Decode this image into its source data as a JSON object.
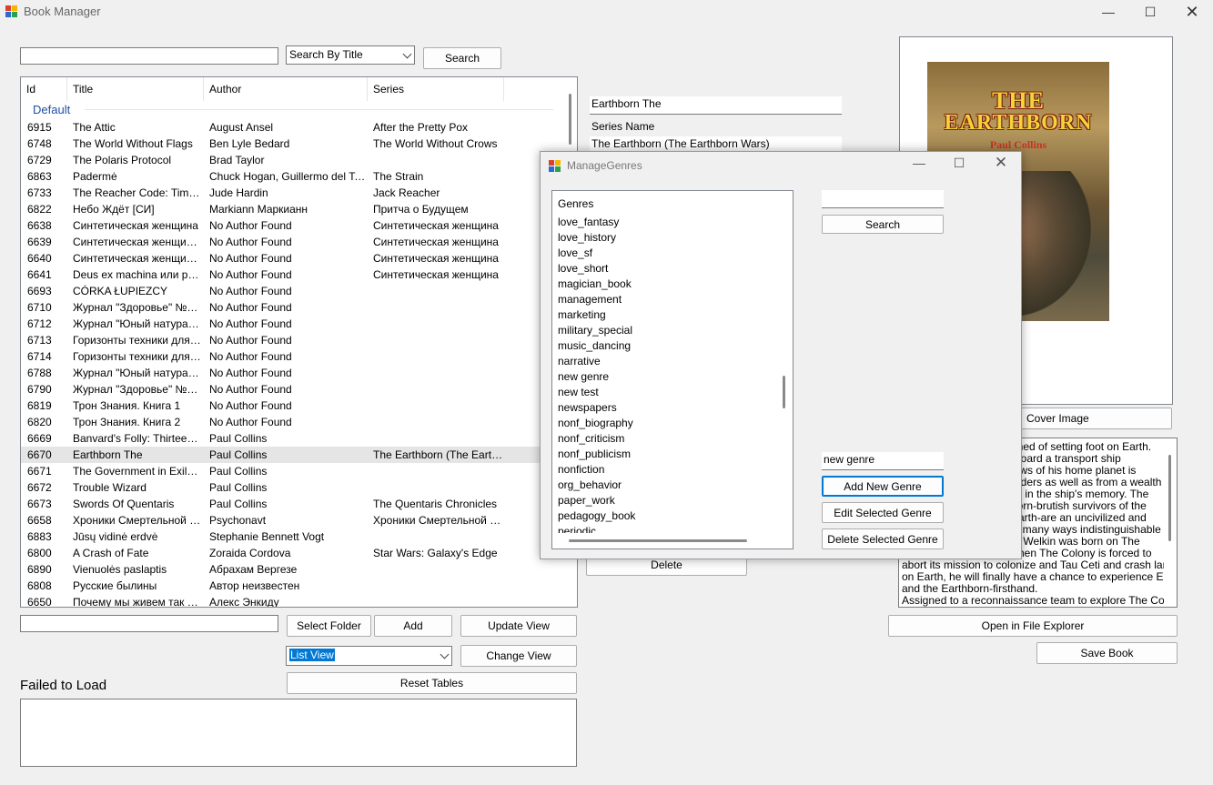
{
  "window": {
    "title": "Book Manager"
  },
  "search": {
    "query": "",
    "mode": "Search By Title",
    "button": "Search"
  },
  "table": {
    "columns": [
      "Id",
      "Title",
      "Author",
      "Series"
    ],
    "group": "Default",
    "rows": [
      [
        "6915",
        "The Attic",
        "August Ansel",
        "After the Pretty Pox"
      ],
      [
        "6748",
        "The World Without Flags",
        "Ben Lyle Bedard",
        "The World Without Crows"
      ],
      [
        "6729",
        "The Polaris Protocol",
        "Brad Taylor",
        ""
      ],
      [
        "6863",
        "Padermė",
        "Chuck Hogan, Guillermo del Toro",
        "The Strain"
      ],
      [
        "6733",
        "The Reacher Code: Timest...",
        "Jude Hardin",
        "Jack Reacher"
      ],
      [
        "6822",
        "Небо Ждёт [СИ]",
        "Markiann Маркианн",
        "Притча о Будущем"
      ],
      [
        "6638",
        "Синтетическая женщина",
        "No Author Found",
        "Синтетическая женщина"
      ],
      [
        "6639",
        "Синтетическая женщина 2",
        "No Author Found",
        "Синтетическая женщина"
      ],
      [
        "6640",
        "Синтетическая женщина 3",
        "No Author Found",
        "Синтетическая женщина"
      ],
      [
        "6641",
        "Deus ex machina или раз...",
        "No Author Found",
        "Синтетическая женщина"
      ],
      [
        "6693",
        "CÓRKA ŁUPIEZCY",
        "No Author Found",
        ""
      ],
      [
        "6710",
        "Журнал \"Здоровье\" №3 (...",
        "No Author Found",
        ""
      ],
      [
        "6712",
        "Журнал \"Юный натурали...",
        "No Author Found",
        ""
      ],
      [
        "6713",
        "Горизонты техники для д...",
        "No Author Found",
        ""
      ],
      [
        "6714",
        "Горизонты техники для д...",
        "No Author Found",
        ""
      ],
      [
        "6788",
        "Журнал \"Юный натурали...",
        "No Author Found",
        ""
      ],
      [
        "6790",
        "Журнал \"Здоровье\" №4 (...",
        "No Author Found",
        ""
      ],
      [
        "6819",
        "Трон Знания. Книга 1",
        "No Author Found",
        ""
      ],
      [
        "6820",
        "Трон Знания. Книга 2",
        "No Author Found",
        ""
      ],
      [
        "6669",
        "Banvard's Folly: Thirteen T...",
        "Paul Collins",
        ""
      ],
      [
        "6670",
        "Earthborn The",
        "Paul Collins",
        "The Earthborn (The Earthb..."
      ],
      [
        "6671",
        "The Government in Exile a...",
        "Paul Collins",
        ""
      ],
      [
        "6672",
        "Trouble Wizard",
        "Paul Collins",
        ""
      ],
      [
        "6673",
        "Swords Of Quentaris",
        "Paul Collins",
        "The Quentaris Chronicles"
      ],
      [
        "6658",
        "Хроники Смертельной Б...",
        "Psychonavt",
        "Хроники Смертельной Б..."
      ],
      [
        "6883",
        "Jūsų vidinė erdvė",
        "Stephanie Bennett Vogt",
        ""
      ],
      [
        "6800",
        "A Crash of Fate",
        "Zoraida Cordova",
        "Star Wars: Galaxy's Edge"
      ],
      [
        "6890",
        "Vienuolės paslaptis",
        "Абрахам Вергезе",
        ""
      ],
      [
        "6808",
        "Русские былины",
        "Автор неизвестен",
        ""
      ],
      [
        "6650",
        "Почему мы живем так м...",
        "Алекс Энкиду",
        ""
      ]
    ],
    "selected_id": "6670"
  },
  "folder": {
    "path": "",
    "select_button": "Select Folder",
    "add_button": "Add",
    "update_button": "Update View"
  },
  "view": {
    "mode": "List View",
    "change_button": "Change View",
    "reset_button": "Reset Tables"
  },
  "failed": {
    "label": "Failed to Load",
    "content": ""
  },
  "details": {
    "title": "Earthborn The",
    "series_label": "Series Name",
    "series": "The Earthborn (The Earthborn Wars)",
    "delete_button": "Delete"
  },
  "cover": {
    "title_line1": "THE",
    "title_line2": "EARTHBORN",
    "author": "Paul Collins",
    "button_visible": "Cover Image"
  },
  "description": {
    "lines": [
      "eamed of setting foot on Earth.",
      "r aboard a transport ship",
      "knows of his home planet is",
      "e Elders as well as from a wealth",
      "ived in the ship's memory. The",
      "thborn-brutish survivors of the",
      "o Earth-are an uncivilized and",
      "e in many ways indistinguishable",
      "ugh Welkin was born on The",
      ". When The Colony is forced to",
      "abort its mission to colonize and Tau Ceti and crash lands",
      "on Earth, he will finally have a chance to experience Earth-",
      "and the Earthborn-firsthand.",
      "Assigned to a reconnaissance team to explore The Colony's"
    ]
  },
  "actions": {
    "explorer_button": "Open in File Explorer",
    "save_button": "Save Book"
  },
  "dialog": {
    "title": "ManageGenres",
    "list_header": "Genres",
    "genres": [
      "love_fantasy",
      "love_history",
      "love_sf",
      "love_short",
      "magician_book",
      "management",
      "marketing",
      "military_special",
      "music_dancing",
      "narrative",
      "new genre",
      "new test",
      "newspapers",
      "nonf_biography",
      "nonf_criticism",
      "nonf_publicism",
      "nonfiction",
      "org_behavior",
      "paper_work",
      "pedagogy_book",
      "periodic"
    ],
    "search_value": "",
    "search_button": "Search",
    "new_genre_value": "new genre",
    "add_button": "Add New Genre",
    "edit_button": "Edit Selected Genre",
    "delete_button": "Delete Selected Genre"
  },
  "colors": {
    "accent": "#0078d4",
    "group_header": "#1e4fa8",
    "selection": "#e5e5e5",
    "window_bg": "#f0f0f0"
  }
}
